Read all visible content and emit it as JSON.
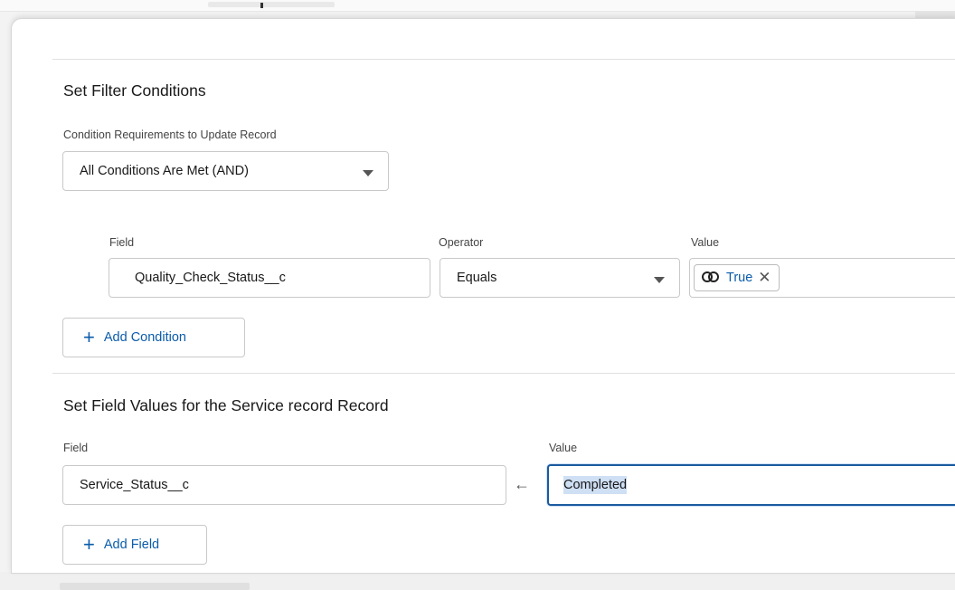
{
  "filter": {
    "heading": "Set Filter Conditions",
    "requirement_label": "Condition Requirements to Update Record",
    "requirement_value": "All Conditions Are Met (AND)",
    "columns": {
      "field": "Field",
      "operator": "Operator",
      "value": "Value"
    },
    "condition": {
      "field": "Quality_Check_Status__c",
      "operator": "Equals",
      "value": "True",
      "value_remove": "✕"
    },
    "add_label": "Add Condition",
    "add_icon": "+"
  },
  "set_values": {
    "heading": "Set Field Values for the Service record Record",
    "field_label": "Field",
    "value_label": "Value",
    "field_value": "Service_Status__c",
    "arrow": "←",
    "value": "Completed",
    "add_label": "Add Field",
    "add_icon": "+"
  },
  "colors": {
    "accent": "#0b5cab",
    "focus_border": "#1b5a9f",
    "highlight": "#cfe0f5"
  }
}
